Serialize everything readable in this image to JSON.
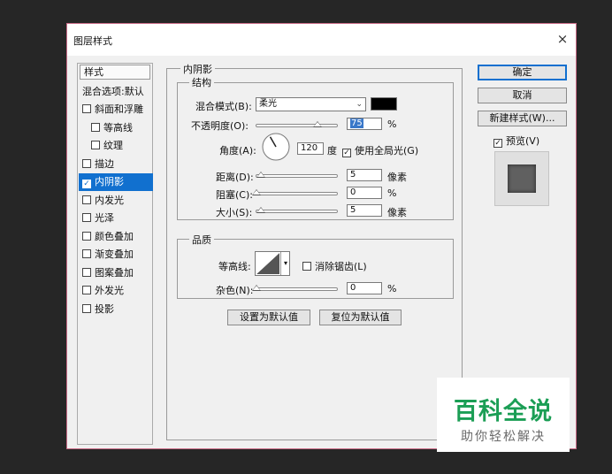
{
  "window": {
    "title": "图层样式",
    "close_glyph": "×"
  },
  "style_list": {
    "header": "样式",
    "blend_options": "混合选项:默认",
    "items": [
      {
        "label": "斜面和浮雕",
        "checked": false
      },
      {
        "label": "等高线",
        "checked": false
      },
      {
        "label": "纹理",
        "checked": false
      },
      {
        "label": "描边",
        "checked": false
      },
      {
        "label": "内阴影",
        "checked": true,
        "selected": true
      },
      {
        "label": "内发光",
        "checked": false
      },
      {
        "label": "光泽",
        "checked": false
      },
      {
        "label": "颜色叠加",
        "checked": false
      },
      {
        "label": "渐变叠加",
        "checked": false
      },
      {
        "label": "图案叠加",
        "checked": false
      },
      {
        "label": "外发光",
        "checked": false
      },
      {
        "label": "投影",
        "checked": false
      }
    ]
  },
  "inner_shadow": {
    "section_title": "内阴影",
    "structure": {
      "title": "结构",
      "blend_mode_label": "混合模式(B):",
      "blend_mode_value": "柔光",
      "shadow_color": "#000000",
      "opacity_label": "不透明度(O):",
      "opacity_value": "75",
      "opacity_fraction": 0.75,
      "percent": "%",
      "angle_label": "角度(A):",
      "angle_value": "120",
      "angle_unit": "度",
      "global_light_label": "使用全局光(G)",
      "global_light_checked": true,
      "distance_label": "距离(D):",
      "distance_value": "5",
      "distance_unit": "像素",
      "choke_label": "阻塞(C):",
      "choke_value": "0",
      "choke_unit": "%",
      "size_label": "大小(S):",
      "size_value": "5",
      "size_unit": "像素"
    },
    "quality": {
      "title": "品质",
      "contour_label": "等高线:",
      "antialias_label": "消除锯齿(L)",
      "antialias_checked": false,
      "noise_label": "杂色(N):",
      "noise_value": "0",
      "noise_unit": "%"
    },
    "make_default_button": "设置为默认值",
    "reset_default_button": "复位为默认值"
  },
  "actions": {
    "ok": "确定",
    "cancel": "取消",
    "new_style": "新建样式(W)...",
    "preview_label": "预览(V)",
    "preview_checked": true
  },
  "watermark": {
    "title": "百科全说",
    "subtitle": "助你轻松解决"
  }
}
